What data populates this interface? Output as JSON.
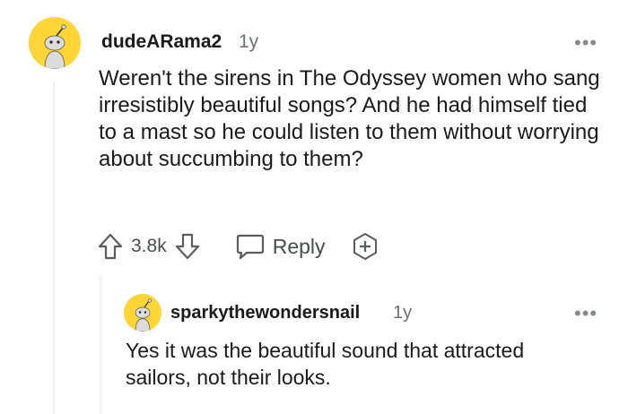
{
  "comment": {
    "username": "dudeARama2",
    "age": "1y",
    "more_label": "•••",
    "text": "Weren't the sirens in The Odyssey women who sang irresistibly beautiful songs? And he had himself tied to a mast so he could listen to them without worrying about succumbing to them?",
    "vote_count": "3.8k",
    "reply_label": "Reply",
    "avatar_color": "#ffd635"
  },
  "reply": {
    "username": "sparkythewondersnail",
    "age": "1y",
    "more_label": "•••",
    "text": "Yes it was the beautiful sound that attracted sailors, not their looks.",
    "avatar_color": "#ffd635"
  },
  "icons": {
    "upvote": "upvote-arrow-icon",
    "downvote": "downvote-arrow-icon",
    "reply": "speech-bubble-icon",
    "award": "plus-award-icon",
    "more": "ellipsis-icon"
  }
}
